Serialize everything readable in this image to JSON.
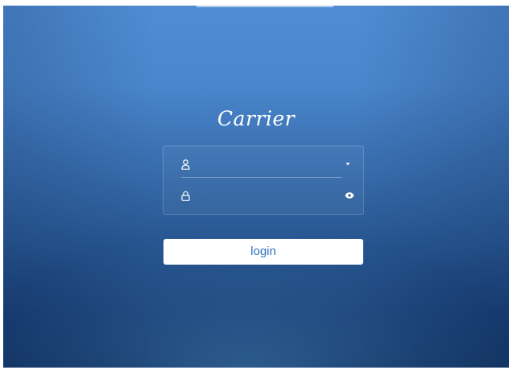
{
  "brand": {
    "logo_text": "Carrier"
  },
  "login_form": {
    "username": {
      "value": "",
      "placeholder": "",
      "icon": "user-icon",
      "trailing_icon": "caret-down-icon"
    },
    "password": {
      "value": "",
      "placeholder": "",
      "icon": "lock-icon",
      "trailing_icon": "eye-icon"
    },
    "submit_label": "login"
  },
  "colors": {
    "background_top": "#4f8cd2",
    "background_bottom": "#123563",
    "button_background": "#ffffff",
    "button_text": "#2e74c0"
  }
}
